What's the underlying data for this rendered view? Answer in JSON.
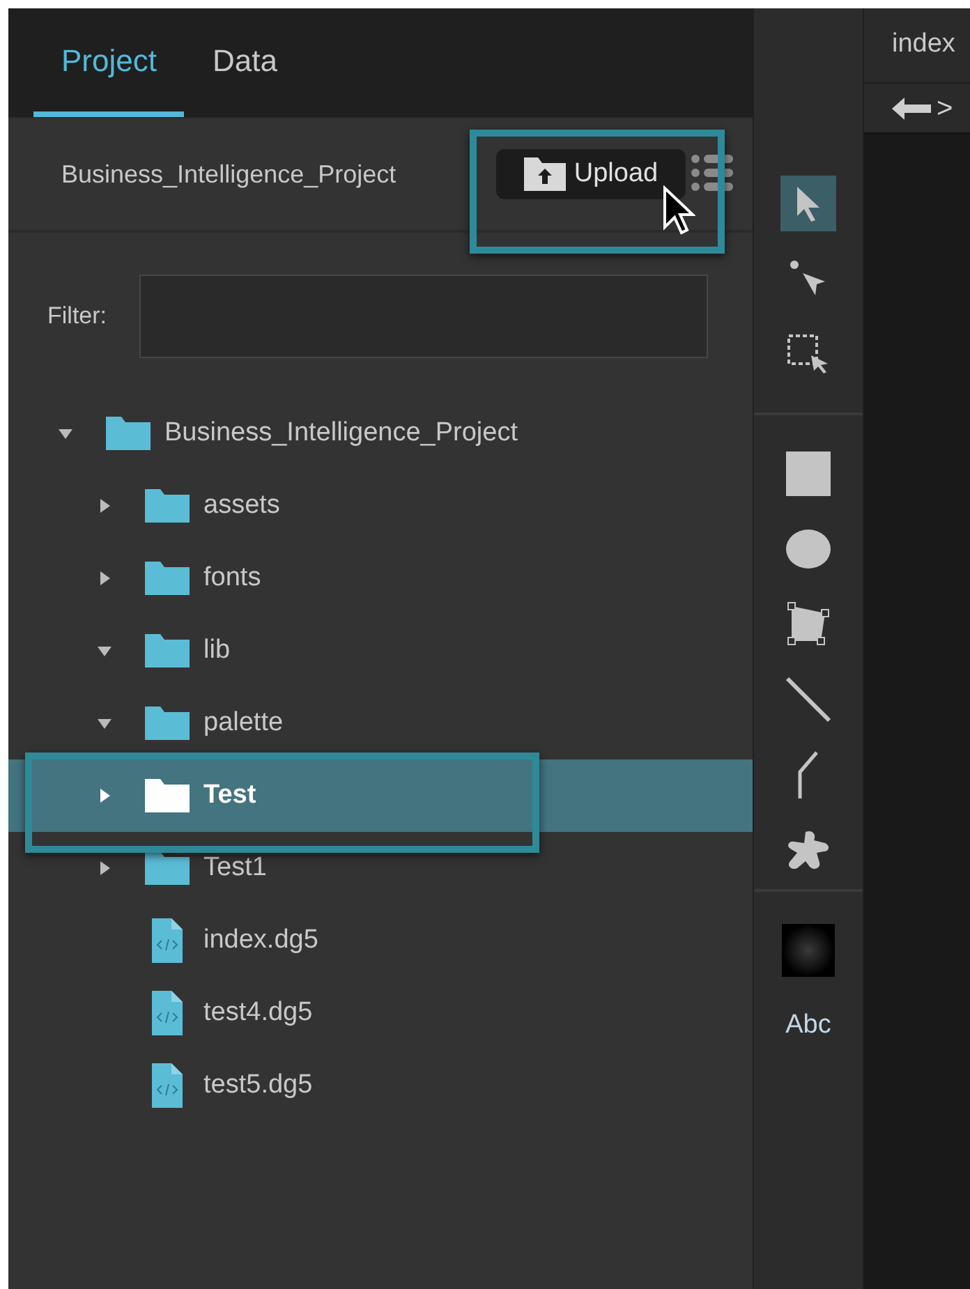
{
  "tabs": [
    {
      "label": "Project",
      "selected": true
    },
    {
      "label": "Data",
      "selected": false
    }
  ],
  "project_bar": {
    "name": "Business_Intelligence_Project",
    "upload_button": "Upload"
  },
  "filter": {
    "label": "Filter:"
  },
  "tree": [
    {
      "name": "Business_Intelligence_Project",
      "kind": "folder",
      "expanded": true,
      "selected": false,
      "children": [
        {
          "name": "assets",
          "kind": "folder",
          "expanded": false,
          "selected": false
        },
        {
          "name": "fonts",
          "kind": "folder",
          "expanded": false,
          "selected": false
        },
        {
          "name": "lib",
          "kind": "folder",
          "expanded": true,
          "selected": false
        },
        {
          "name": "palette",
          "kind": "folder",
          "expanded": true,
          "selected": false
        },
        {
          "name": "Test",
          "kind": "folder",
          "expanded": false,
          "selected": true
        },
        {
          "name": "Test1",
          "kind": "folder",
          "expanded": false,
          "selected": false
        },
        {
          "name": "index.dg5",
          "kind": "file",
          "selected": false
        },
        {
          "name": "test4.dg5",
          "kind": "file",
          "selected": false
        },
        {
          "name": "test5.dg5",
          "kind": "file",
          "selected": false
        }
      ]
    }
  ],
  "tool_groups": [
    {
      "tools": [
        {
          "kind": "select",
          "selected": true
        },
        {
          "kind": "direct-select",
          "selected": false
        },
        {
          "kind": "marquee",
          "selected": false
        }
      ]
    },
    {
      "tools": [
        {
          "kind": "rectangle",
          "selected": false
        },
        {
          "kind": "ellipse",
          "selected": false
        },
        {
          "kind": "polygon",
          "selected": false
        },
        {
          "kind": "line",
          "selected": false
        },
        {
          "kind": "polyline",
          "selected": false
        },
        {
          "kind": "blob",
          "selected": false
        }
      ]
    },
    {
      "tools": [
        {
          "kind": "gradient",
          "selected": false
        },
        {
          "kind": "text",
          "label": "Abc",
          "selected": false
        }
      ]
    }
  ],
  "editor": {
    "tab": "index",
    "breadcrumb": ">"
  }
}
